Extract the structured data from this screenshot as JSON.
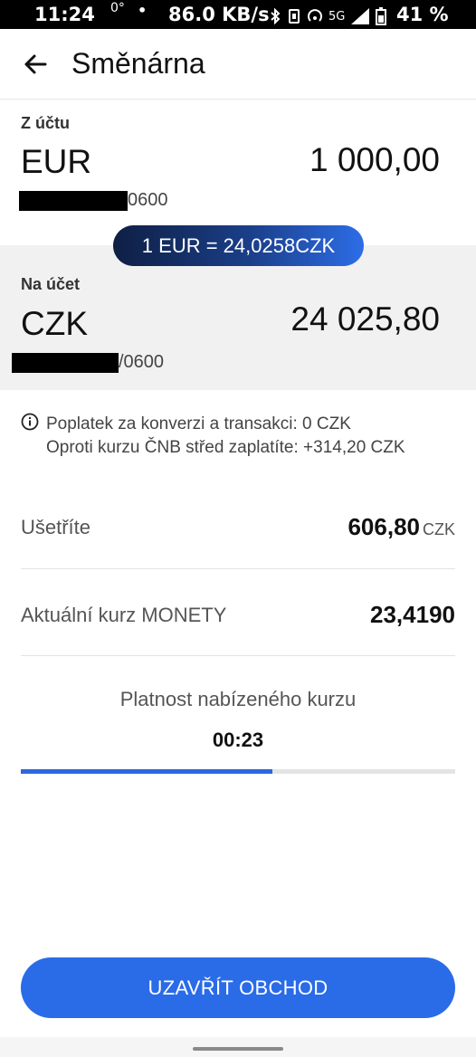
{
  "status_bar": {
    "time": "11:24",
    "temp": "0°",
    "dot": "•",
    "speed": "86.0 KB/s",
    "network": "5G",
    "battery": "41 %"
  },
  "header": {
    "title": "Směnárna",
    "back_icon": "arrow-left-icon"
  },
  "from_account": {
    "label": "Z účtu",
    "currency": "EUR",
    "amount": "1 000,00",
    "account_suffix": "0600"
  },
  "rate_pill": {
    "text": "1 EUR = 24,0258CZK"
  },
  "to_account": {
    "label": "Na účet",
    "currency": "CZK",
    "amount": "24 025,80",
    "account_suffix": "/0600"
  },
  "fees": {
    "icon": "info-icon",
    "line1": "Poplatek za konverzi a transakci: 0 CZK",
    "line2": "Oproti kurzu ČNB střed zaplatíte: +314,20 CZK"
  },
  "summary": {
    "savings_label": "Ušetříte",
    "savings_value": "606,80",
    "savings_unit": "CZK",
    "rate_label": "Aktuální kurz MONETY",
    "rate_value": "23,4190"
  },
  "validity": {
    "label": "Platnost nabízeného kurzu",
    "countdown": "00:23",
    "progress_fraction": 0.58
  },
  "actions": {
    "confirm_label": "UZAVŘÍT OBCHOD"
  },
  "colors": {
    "accent": "#2a6be8",
    "pill_dark": "#0e1f44",
    "section_bg": "#f1f1f1"
  }
}
